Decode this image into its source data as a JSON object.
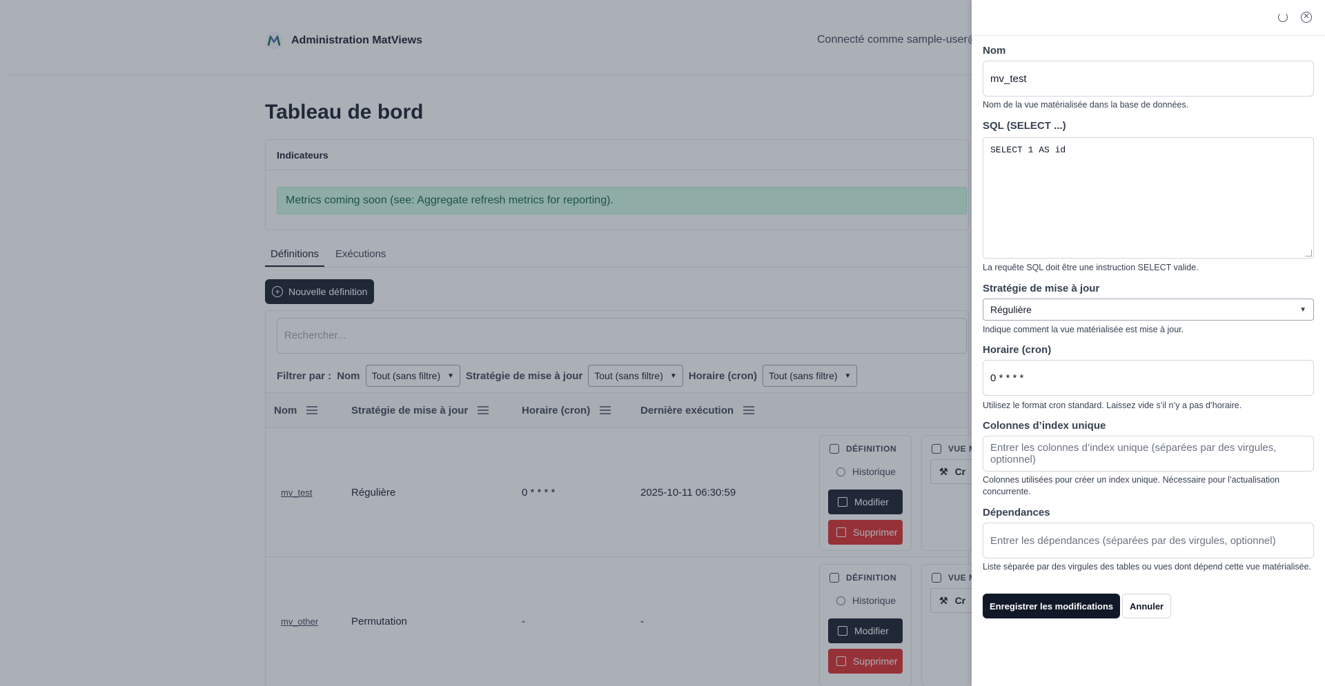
{
  "app": {
    "title": "Administration MatViews",
    "user_text": "Connecté comme sample-user@e"
  },
  "page": {
    "title": "Tableau de bord",
    "metrics_card_title": "Indicateurs",
    "metrics_alert": "Metrics coming soon (see: Aggregate refresh metrics for reporting).",
    "tabs": [
      {
        "label": "Définitions",
        "active": true
      },
      {
        "label": "Exécutions",
        "active": false
      }
    ],
    "new_definition_label": "Nouvelle définition",
    "search_placeholder": "Rechercher...",
    "filter": {
      "label": "Filtrer par :",
      "fields": [
        {
          "label": "Nom",
          "value": "Tout (sans filtre)"
        },
        {
          "label": "Stratégie de mise à jour",
          "value": "Tout (sans filtre)"
        },
        {
          "label": "Horaire (cron)",
          "value": "Tout (sans filtre)"
        }
      ]
    },
    "table": {
      "columns": [
        "Nom",
        "Stratégie de mise à jour",
        "Horaire (cron)",
        "Dernière exécution"
      ],
      "rows": [
        {
          "name": "mv_test",
          "strategy": "Régulière",
          "cron": "0 * * * *",
          "last_run": "2025-10-11 06:30:59"
        },
        {
          "name": "mv_other",
          "strategy": "Permutation",
          "cron": "-",
          "last_run": "-"
        }
      ],
      "panel": {
        "definition_title": "DÉFINITION",
        "history_label": "Historique",
        "edit_label": "Modifier",
        "delete_label": "Supprimer",
        "view_title": "VUE M",
        "create_label": "Cr"
      }
    }
  },
  "drawer": {
    "name": {
      "label": "Nom",
      "value": "mv_test",
      "help": "Nom de la vue matérialisée dans la base de données."
    },
    "sql": {
      "label": "SQL (SELECT ...)",
      "value": "SELECT 1 AS id",
      "help": "La requête SQL doit être une instruction SELECT valide."
    },
    "strategy": {
      "label": "Stratégie de mise à jour",
      "value": "Régulière",
      "help": "Indique comment la vue matérialisée est mise à jour."
    },
    "cron": {
      "label": "Horaire (cron)",
      "value": "0 * * * *",
      "help": "Utilisez le format cron standard. Laissez vide s’il n’y a pas d’horaire."
    },
    "unique_index": {
      "label": "Colonnes d’index unique",
      "placeholder": "Entrer les colonnes d’index unique (séparées par des virgules, optionnel)",
      "help": "Colonnes utilisées pour créer un index unique. Nécessaire pour l’actualisation concurrente."
    },
    "dependencies": {
      "label": "Dépendances",
      "placeholder": "Entrer les dépendances (séparées par des virgules, optionnel)",
      "help": "Liste séparée par des virgules des tables ou vues dont dépend cette vue matérialisée."
    },
    "save_label": "Enregistrer les modifications",
    "cancel_label": "Annuler"
  },
  "colors": {
    "primary": "#111827",
    "danger": "#dc2626",
    "success_bg": "#d1fae5",
    "success_text": "#065f46",
    "overlay": "rgba(55,65,81,0.42)"
  },
  "icons": {
    "logo": "matviews-logo-icon",
    "new_definition": "plus-circle-icon",
    "column_menu": "menu-icon",
    "definition": "layers-icon",
    "history": "history-icon",
    "edit": "edit-icon",
    "delete": "trash-icon",
    "view": "database-icon",
    "create": "hammer-icon",
    "refresh": "refresh-icon",
    "close": "close-icon"
  }
}
